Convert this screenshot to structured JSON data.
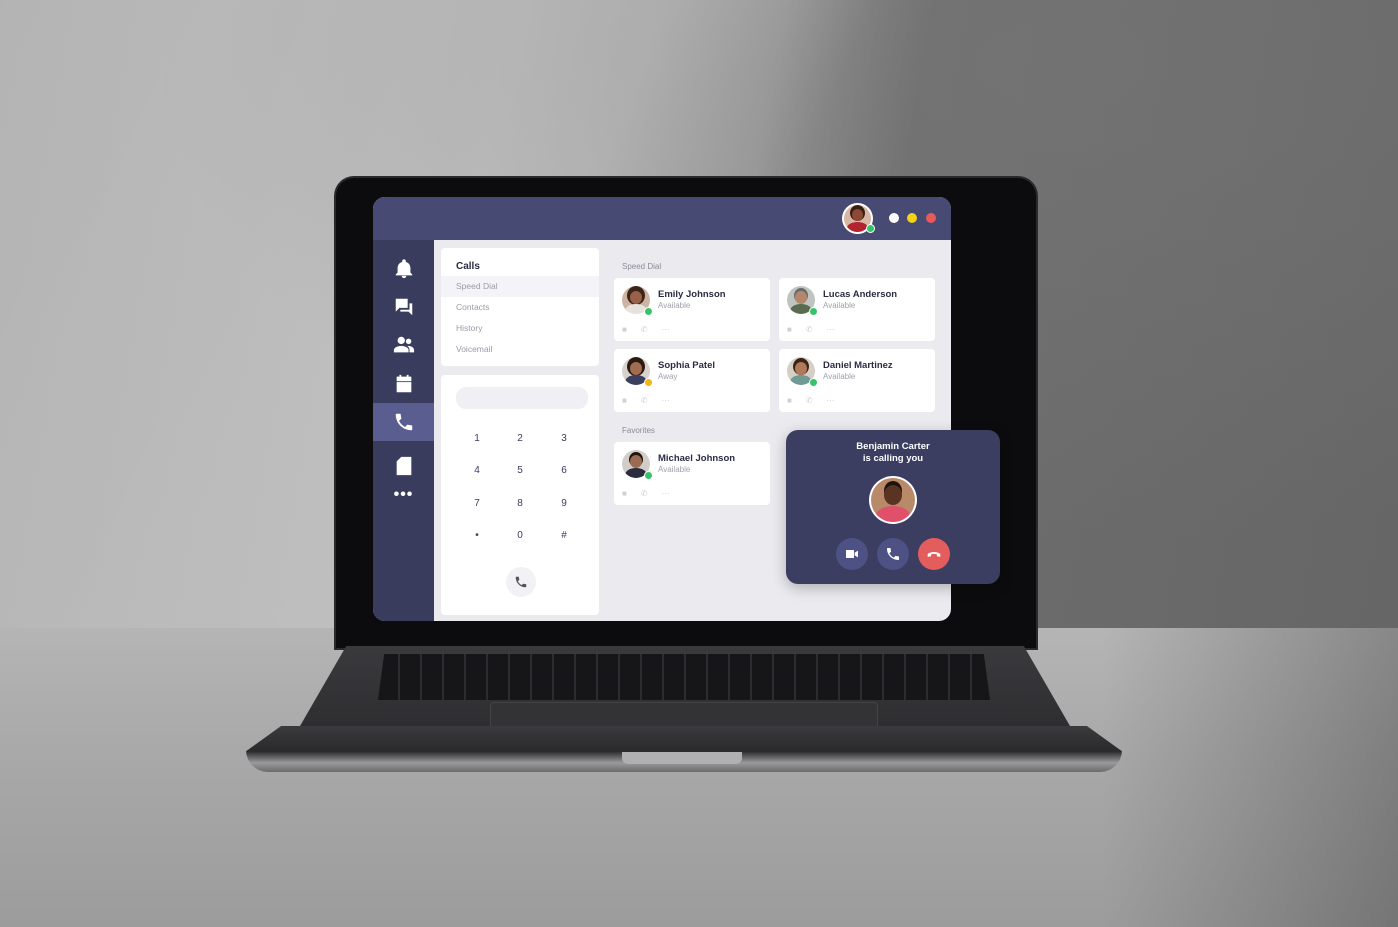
{
  "colors": {
    "titlebar": "#474a73",
    "sidebar": "#3a3c5e",
    "sidebar_active": "#5a5d8f",
    "window_dots": [
      "#ffffff",
      "#f2d21b",
      "#e85a5a"
    ],
    "available": "#37c36a",
    "away": "#f2b51b",
    "decline": "#e35d5d"
  },
  "titlebar": {
    "user_avatar_icon": "user-avatar-icon",
    "window_controls": [
      "white-dot",
      "yellow-dot",
      "red-dot"
    ]
  },
  "sidebar": {
    "items": [
      {
        "icon": "bell-icon",
        "active": false
      },
      {
        "icon": "chat-icon",
        "active": false
      },
      {
        "icon": "people-icon",
        "active": false
      },
      {
        "icon": "calendar-icon",
        "active": false
      },
      {
        "icon": "phone-icon",
        "active": true
      },
      {
        "icon": "file-icon",
        "active": false
      },
      {
        "icon": "more-icon",
        "active": false
      }
    ],
    "more_label": "•••"
  },
  "calls_menu": {
    "title": "Calls",
    "items": [
      "Speed Dial",
      "Contacts",
      "History",
      "Voicemail"
    ],
    "selected": "Speed Dial"
  },
  "dialpad": {
    "keys": [
      "1",
      "2",
      "3",
      "4",
      "5",
      "6",
      "7",
      "8",
      "9",
      "•",
      "0",
      "#"
    ],
    "call_icon": "phone-icon"
  },
  "speed_dial": {
    "label": "Speed Dial",
    "contacts": [
      {
        "name": "Emily Johnson",
        "status": "Available"
      },
      {
        "name": "Lucas Anderson",
        "status": "Available"
      },
      {
        "name": "Sophia Patel",
        "status": "Away"
      },
      {
        "name": "Daniel Martinez",
        "status": "Available"
      }
    ]
  },
  "favorites": {
    "label": "Favorites",
    "contacts": [
      {
        "name": "Michael Johnson",
        "status": "Available"
      }
    ]
  },
  "contact_actions": [
    "video-icon",
    "phone-icon",
    "more-icon"
  ],
  "incoming_call": {
    "line1": "Benjamin Carter",
    "line2": "is calling you",
    "buttons": [
      "video-icon",
      "phone-icon",
      "hangup-icon"
    ]
  }
}
